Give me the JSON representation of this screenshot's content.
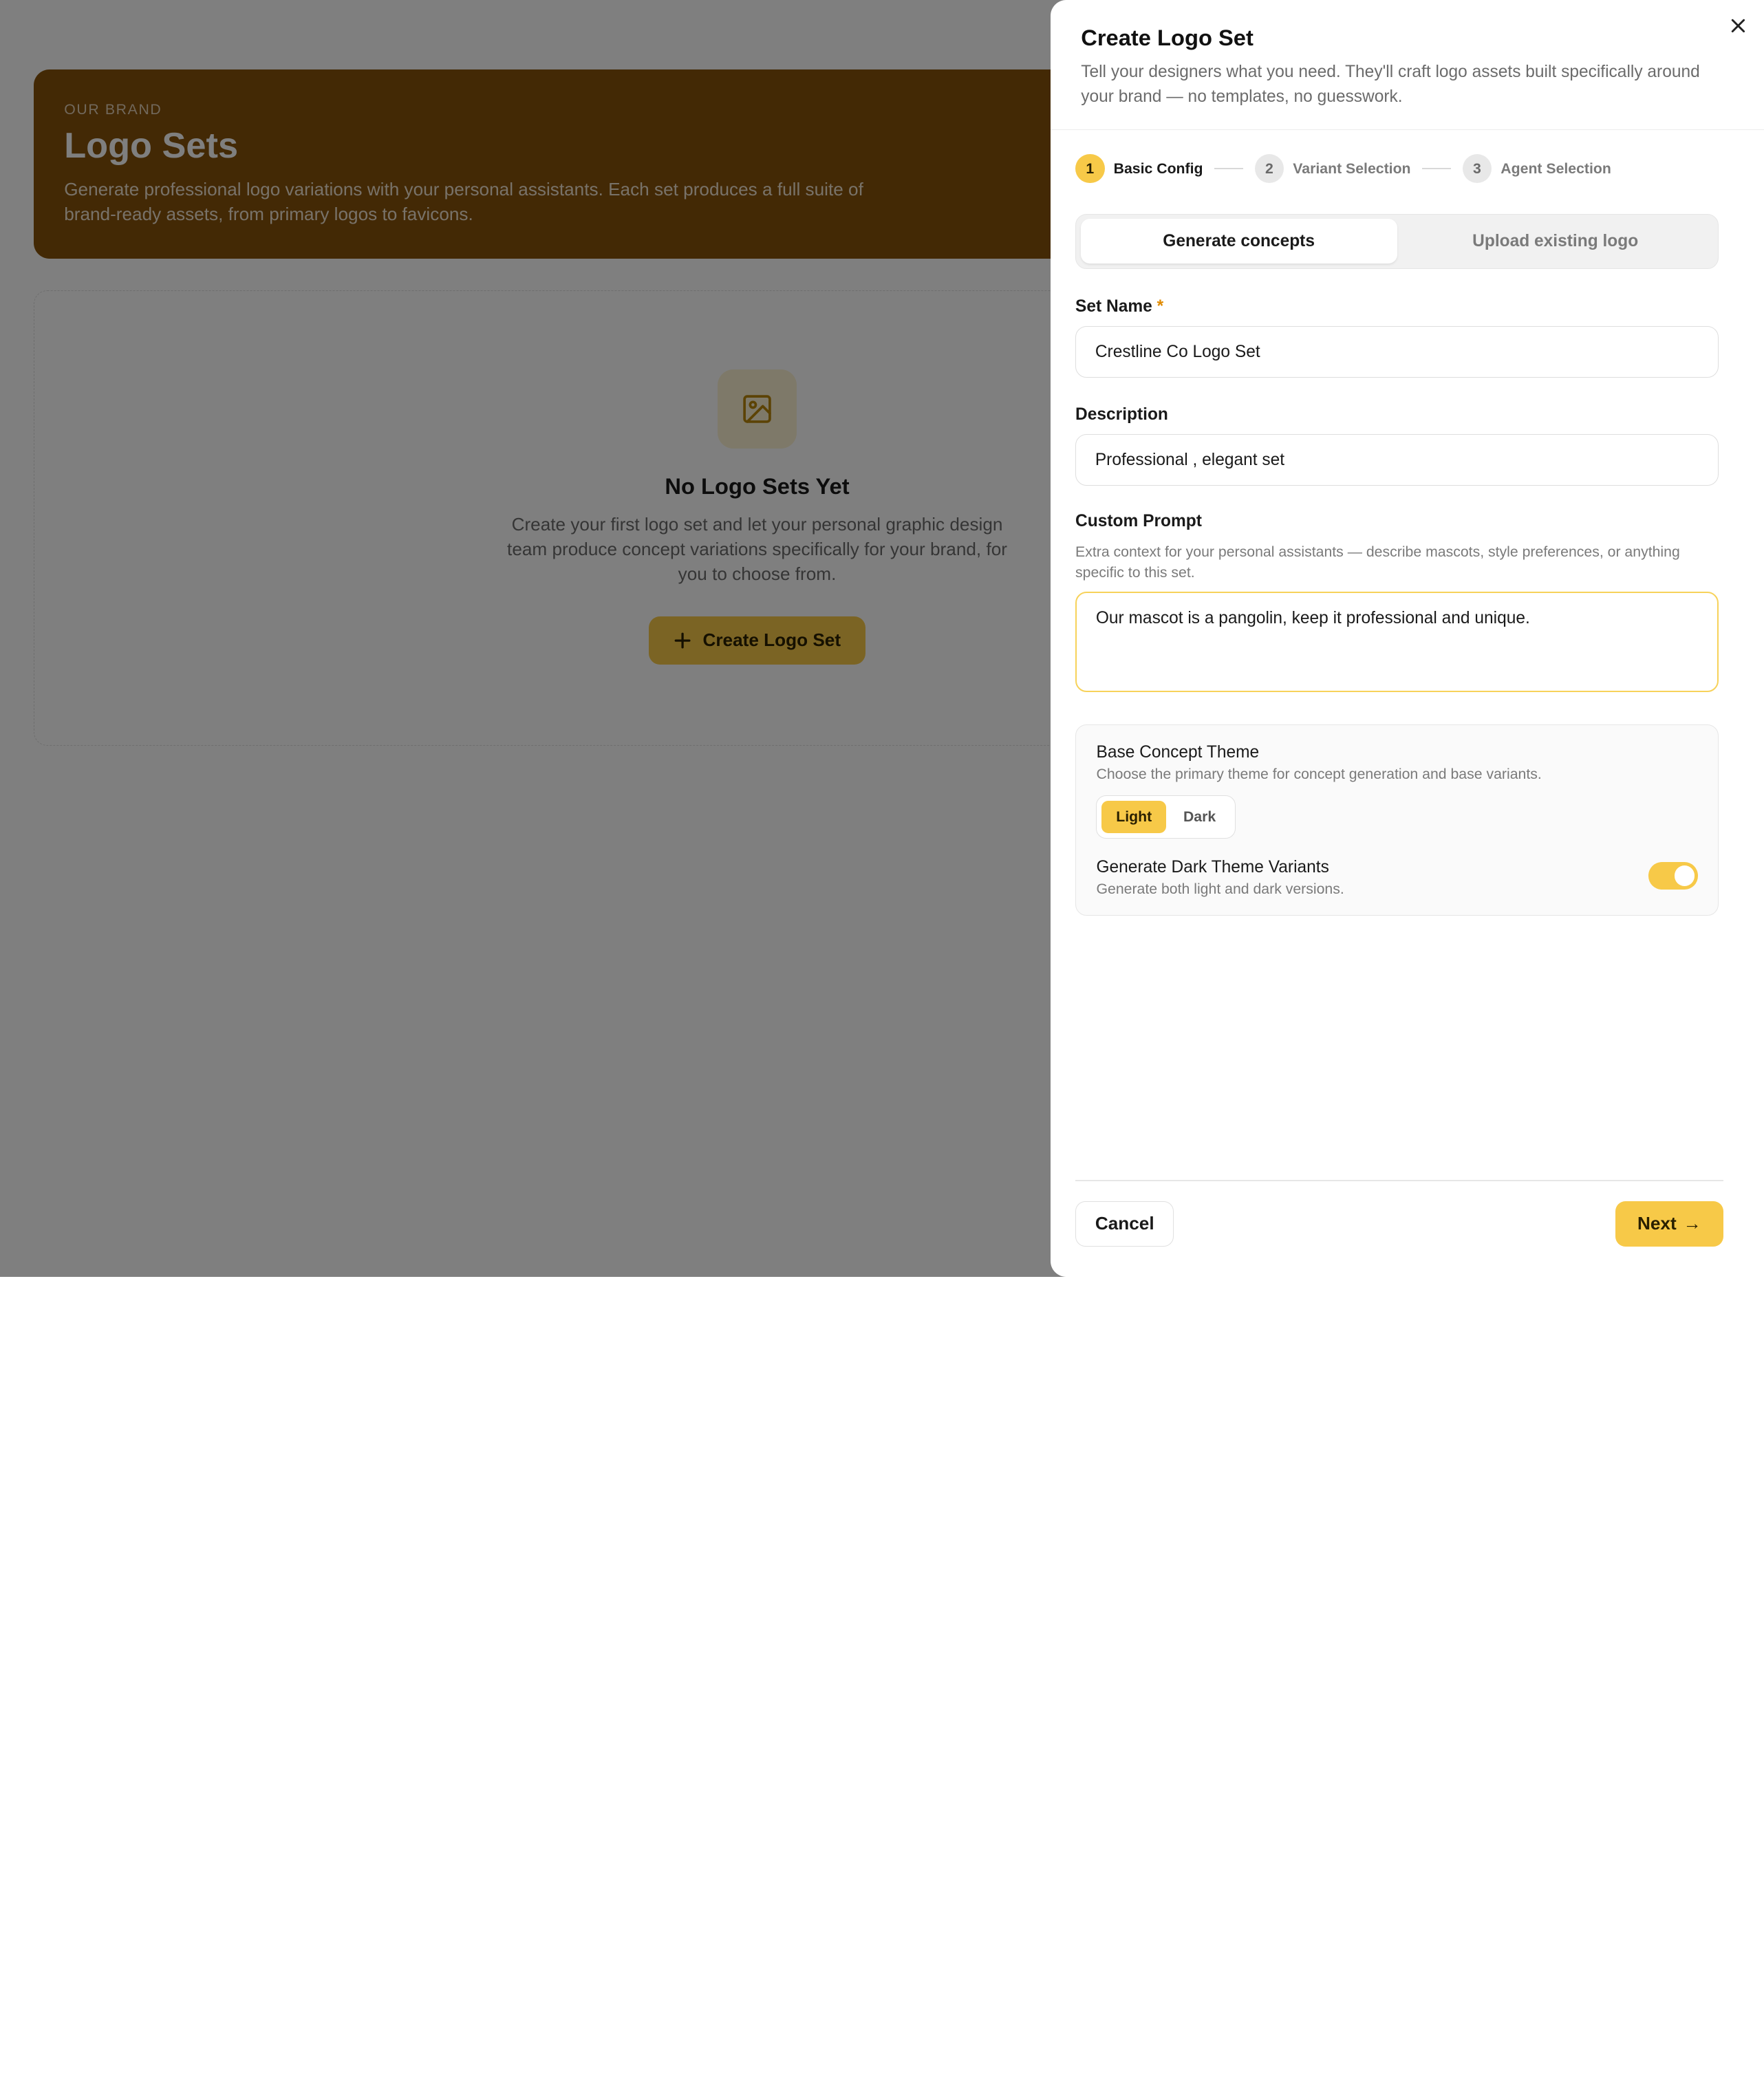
{
  "background": {
    "hero": {
      "eyebrow": "OUR BRAND",
      "title": "Logo Sets",
      "description": "Generate professional logo variations with your personal assistants. Each set produces a full suite of brand-ready assets, from primary logos to favicons."
    },
    "empty_state": {
      "icon": "image-icon",
      "title": "No Logo Sets Yet",
      "description": "Create your first logo set and let your personal graphic design team produce concept variations specifically for your brand, for you to choose from.",
      "create_button": "Create Logo Set"
    }
  },
  "drawer": {
    "title": "Create Logo Set",
    "subtitle": "Tell your designers what you need. They'll craft logo assets built specifically around your brand — no templates, no guesswork.",
    "steps": [
      {
        "num": "1",
        "label": "Basic Config"
      },
      {
        "num": "2",
        "label": "Variant Selection"
      },
      {
        "num": "3",
        "label": "Agent Selection"
      }
    ],
    "mode_tabs": [
      "Generate concepts",
      "Upload existing logo"
    ],
    "fields": {
      "set_name": {
        "label": "Set Name",
        "required_marker": "*",
        "value": "Crestline Co Logo Set"
      },
      "description": {
        "label": "Description",
        "value": "Professional , elegant set"
      },
      "custom_prompt": {
        "label": "Custom Prompt",
        "helper": "Extra context for your personal assistants — describe mascots, style preferences, or anything specific to this set.",
        "value": "Our mascot is a pangolin, keep it professional and unique."
      }
    },
    "theme": {
      "title": "Base Concept Theme",
      "subtitle": "Choose the primary theme for concept generation and base variants.",
      "options": [
        "Light",
        "Dark"
      ],
      "selected": "Light",
      "dark_variants_title": "Generate Dark Theme Variants",
      "dark_variants_subtitle": "Generate both light and dark versions.",
      "dark_variants_enabled": true
    },
    "footer": {
      "cancel": "Cancel",
      "next": "Next",
      "next_icon": "→"
    }
  },
  "colors": {
    "accent": "#f7c948",
    "hero_brown": "#87520a"
  }
}
